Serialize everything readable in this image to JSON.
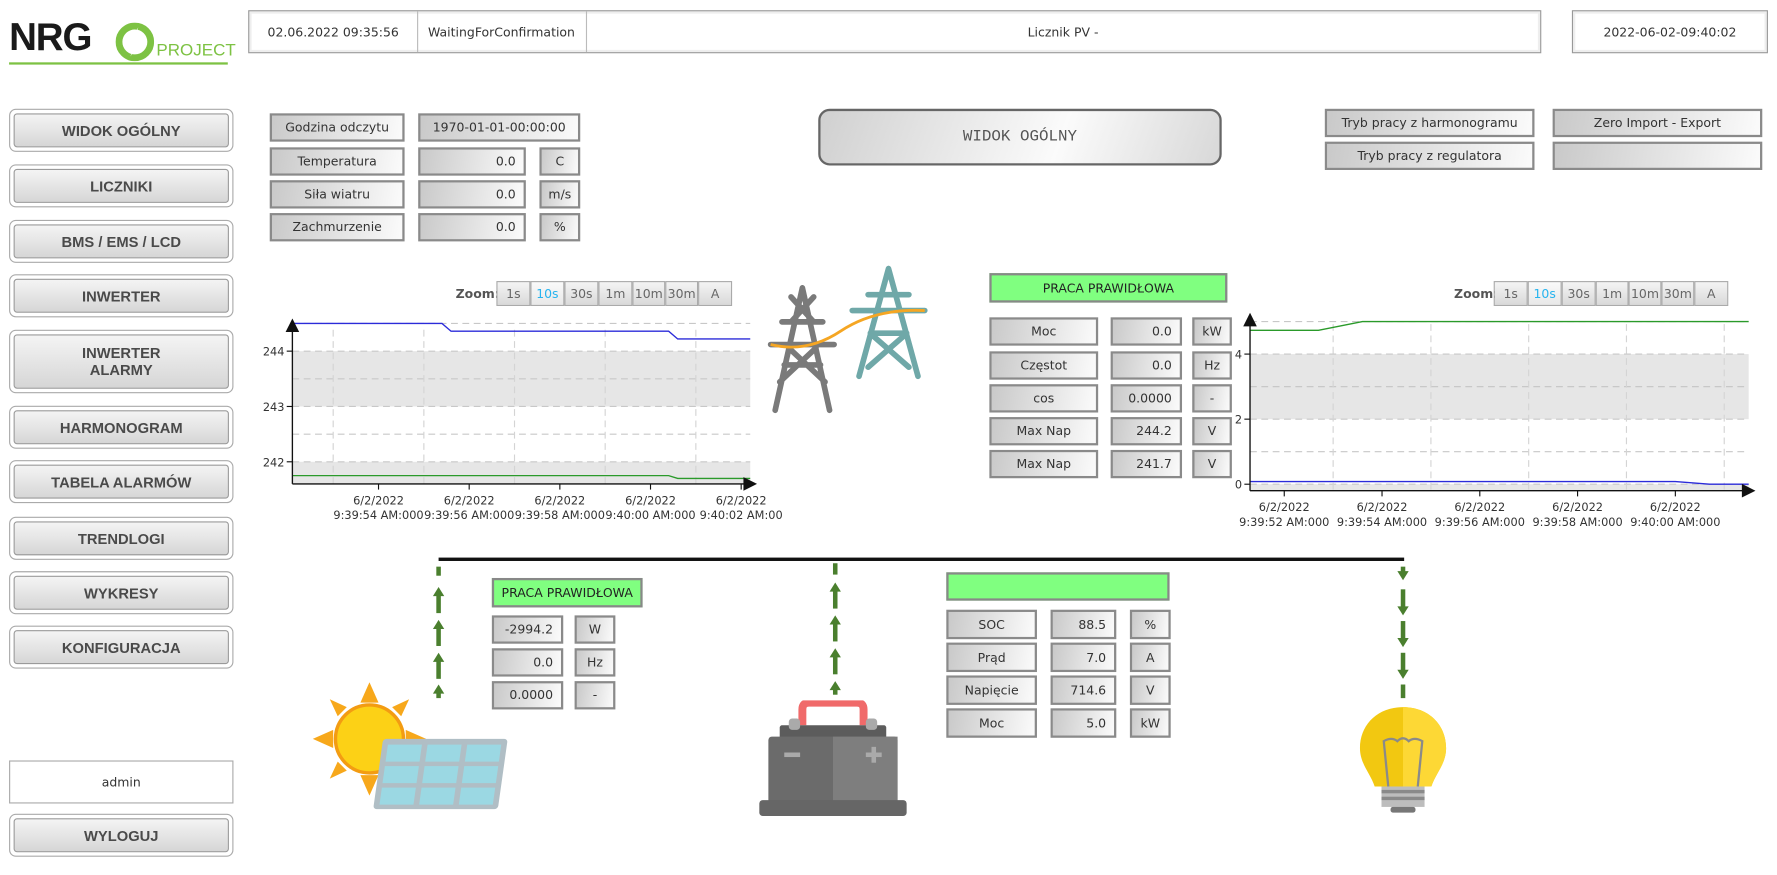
{
  "logo": {
    "text": "NRG",
    "sub": "PROJECT",
    "color": "#7dc243"
  },
  "header": {
    "datetime": "02.06.2022 09:35:56",
    "status": "WaitingForConfirmation",
    "title": "Licznik PV -",
    "clock": "2022-06-02-09:40:02"
  },
  "sidebar": {
    "items": [
      {
        "label": "WIDOK OGÓLNY"
      },
      {
        "label": "LICZNIKI"
      },
      {
        "label": "BMS / EMS / LCD"
      },
      {
        "label": "INWERTER"
      },
      {
        "label": "INWERTER ALARMY"
      },
      {
        "label": "HARMONOGRAM"
      },
      {
        "label": "TABELA ALARMÓW"
      },
      {
        "label": "TRENDLOGI"
      },
      {
        "label": "WYKRESY"
      },
      {
        "label": "KONFIGURACJA"
      }
    ],
    "user": "admin",
    "logout": "WYLOGUJ"
  },
  "page_title": "WIDOK OGÓLNY",
  "weather": {
    "rows": [
      {
        "label": "Godzina odczytu",
        "value": "1970-01-01-00:00:00",
        "unit": ""
      },
      {
        "label": "Temperatura",
        "value": "0.0",
        "unit": "C"
      },
      {
        "label": "Siła wiatru",
        "value": "0.0",
        "unit": "m/s"
      },
      {
        "label": "Zachmurzenie",
        "value": "0.0",
        "unit": "%"
      }
    ]
  },
  "modes": {
    "schedule": "Tryb pracy z harmonogramu",
    "regulator": "Tryb pracy z regulatora",
    "zero": "Zero Import - Export",
    "empty": ""
  },
  "zoom": {
    "label": "Zoom:",
    "options": [
      "1s",
      "10s",
      "30s",
      "1m",
      "10m",
      "30m",
      "A"
    ],
    "active": "10s"
  },
  "grid": {
    "status": "PRACA PRAWIDŁOWA",
    "rows": [
      {
        "label": "Moc",
        "value": "0.0",
        "unit": "kW"
      },
      {
        "label": "Częstot",
        "value": "0.0",
        "unit": "Hz"
      },
      {
        "label": "cos",
        "value": "0.0000",
        "unit": "-"
      },
      {
        "label": "Max Nap",
        "value": "244.2",
        "unit": "V"
      },
      {
        "label": "Max Nap",
        "value": "241.7",
        "unit": "V"
      }
    ]
  },
  "pv": {
    "status": "PRACA PRAWIDŁOWA",
    "rows": [
      {
        "value": "-2994.2",
        "unit": "W"
      },
      {
        "value": "0.0",
        "unit": "Hz"
      },
      {
        "value": "0.0000",
        "unit": "-"
      }
    ]
  },
  "battery": {
    "status": "",
    "rows": [
      {
        "label": "SOC",
        "value": "88.5",
        "unit": "%"
      },
      {
        "label": "Prąd",
        "value": "7.0",
        "unit": "A"
      },
      {
        "label": "Napięcie",
        "value": "714.6",
        "unit": "V"
      },
      {
        "label": "Moc",
        "value": "5.0",
        "unit": "kW"
      }
    ]
  },
  "colors": {
    "ok": "#80ff80",
    "flow_arrow": "#4a7f2e",
    "series_blue": "#2b2bd9",
    "series_green": "#2a9a2a",
    "band": "#e6e6e6"
  },
  "chart_data": [
    {
      "type": "line",
      "xlim": [
        "9:39:52.1",
        "9:40:02.2"
      ],
      "ylim": [
        241.6,
        244.55
      ],
      "yticks": [
        242,
        243,
        244
      ],
      "ytick_labels": [
        "242",
        "243",
        "244"
      ],
      "ygrid": [
        242,
        242.5,
        243,
        243.5,
        244,
        244.5
      ],
      "xgrid": [
        "9:39:53",
        "9:39:55",
        "9:39:57",
        "9:39:59",
        "9:40:01"
      ],
      "xticks": [
        "9:39:54",
        "9:39:56",
        "9:39:58",
        "9:40:00",
        "9:40:02"
      ],
      "xtick_labels": [
        [
          "6/2/2022",
          "9:39:54 AM:000"
        ],
        [
          "6/2/2022",
          "9:39:56 AM:000"
        ],
        [
          "6/2/2022",
          "9:39:58 AM:000"
        ],
        [
          "6/2/2022",
          "9:40:00 AM:000"
        ],
        [
          "6/2/2022",
          "9:40:02 AM:00"
        ]
      ],
      "bands": [
        [
          243,
          244
        ],
        [
          241.6,
          242
        ]
      ],
      "grid": true,
      "series": [
        {
          "color": "#2b2bd9",
          "points": [
            [
              "9:39:52.1",
              244.5
            ],
            [
              "9:39:55.4",
              244.5
            ],
            [
              "9:39:55.6",
              244.36
            ],
            [
              "9:40:00.4",
              244.36
            ],
            [
              "9:40:00.6",
              244.22
            ],
            [
              "9:40:02.2",
              244.22
            ]
          ]
        },
        {
          "color": "#2a9a2a",
          "points": [
            [
              "9:39:52.1",
              241.75
            ],
            [
              "9:40:00.4",
              241.75
            ],
            [
              "9:40:00.6",
              241.7
            ],
            [
              "9:40:02.2",
              241.7
            ]
          ]
        }
      ]
    },
    {
      "type": "line",
      "xlim": [
        "9:39:51.3",
        "9:40:01.5"
      ],
      "ylim": [
        -0.2,
        5.2
      ],
      "yticks": [
        0,
        2,
        4
      ],
      "ytick_labels": [
        "0",
        "2",
        "4"
      ],
      "ygrid": [
        0,
        1,
        2,
        3,
        4,
        5
      ],
      "xgrid": [
        "9:39:53",
        "9:39:55",
        "9:39:57",
        "9:39:59",
        "9:40:01"
      ],
      "xticks": [
        "9:39:52",
        "9:39:54",
        "9:39:56",
        "9:39:58",
        "9:40:00"
      ],
      "xtick_labels": [
        [
          "6/2/2022",
          "9:39:52 AM:000"
        ],
        [
          "6/2/2022",
          "9:39:54 AM:000"
        ],
        [
          "6/2/2022",
          "9:39:56 AM:000"
        ],
        [
          "6/2/2022",
          "9:39:58 AM:000"
        ],
        [
          "6/2/2022",
          "9:40:00 AM:000"
        ]
      ],
      "bands": [
        [
          2,
          4
        ],
        [
          -0.2,
          0
        ]
      ],
      "grid": true,
      "series": [
        {
          "color": "#2a9a2a",
          "points": [
            [
              "9:39:51.3",
              4.73
            ],
            [
              "9:39:52.7",
              4.73
            ],
            [
              "9:39:53.6",
              5.0
            ],
            [
              "9:40:01.5",
              5.0
            ]
          ]
        },
        {
          "color": "#2b2bd9",
          "points": [
            [
              "9:39:51.3",
              0.08
            ],
            [
              "9:40:00.0",
              0.08
            ],
            [
              "9:40:00.7",
              0.0
            ],
            [
              "9:40:01.5",
              0.0
            ]
          ]
        }
      ]
    }
  ]
}
